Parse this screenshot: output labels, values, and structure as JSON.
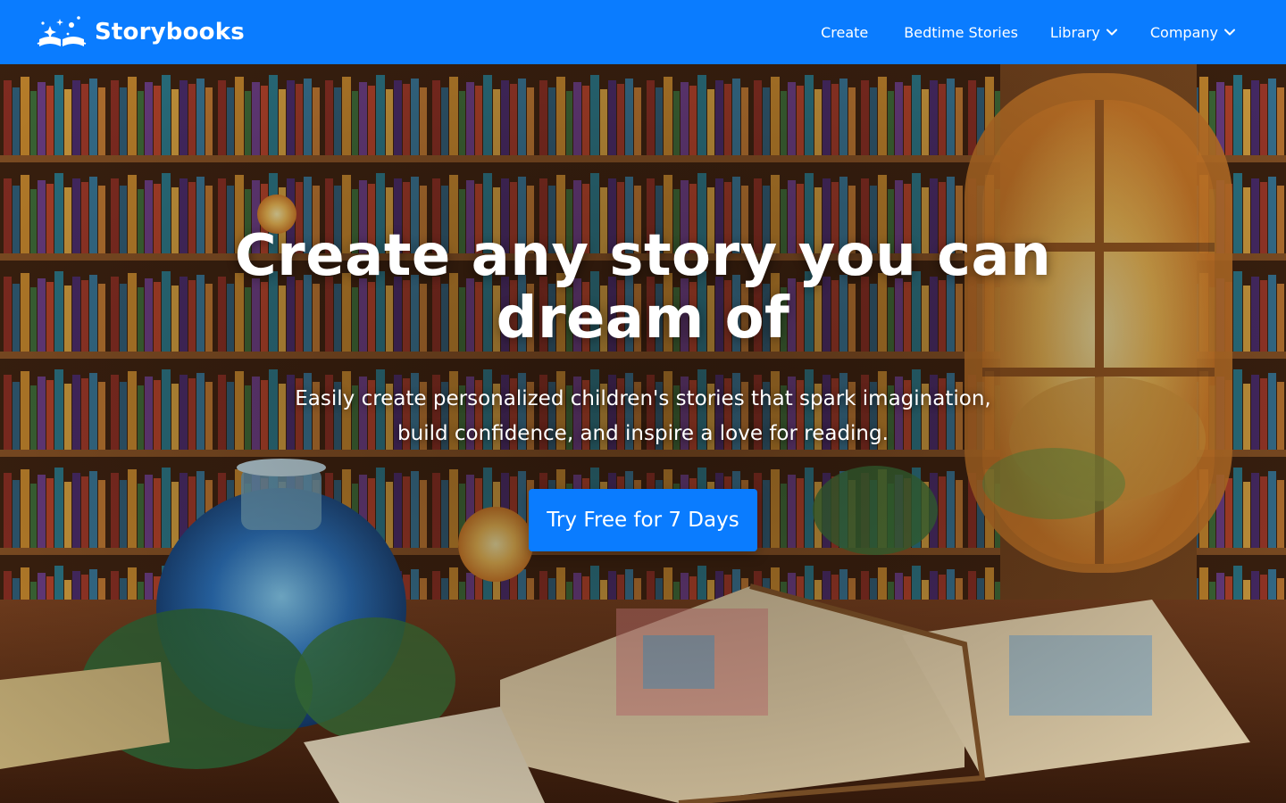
{
  "navbar": {
    "brand": {
      "name": "Storybooks",
      "logo_icon": "open-book-stars-icon"
    },
    "links": [
      {
        "label": "Create"
      },
      {
        "label": "Bedtime Stories"
      },
      {
        "label": "Library",
        "icon": "chevron-down-icon"
      },
      {
        "label": "Company",
        "icon": "chevron-down-icon"
      }
    ]
  },
  "hero": {
    "headline": "Create any story you can dream of",
    "subhead": "Easily create personalized children's stories that spark imagination, build confidence, and inspire a love for reading.",
    "cta_label": "Try Free for 7 Days",
    "background": "illustrated-library-with-open-book"
  },
  "colors": {
    "brand_blue": "#0a7cff",
    "text_white": "#ffffff"
  }
}
